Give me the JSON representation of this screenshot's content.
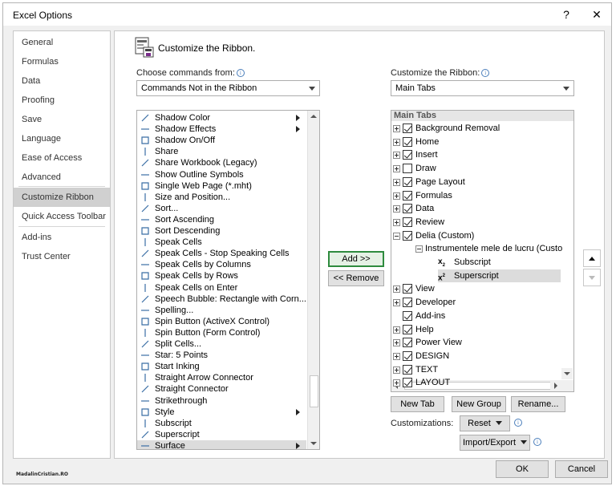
{
  "window": {
    "title": "Excel Options",
    "help_label": "?",
    "close_label": "✕"
  },
  "nav": {
    "items": [
      {
        "label": "General"
      },
      {
        "label": "Formulas"
      },
      {
        "label": "Data"
      },
      {
        "label": "Proofing"
      },
      {
        "label": "Save"
      },
      {
        "label": "Language"
      },
      {
        "label": "Ease of Access"
      },
      {
        "label": "Advanced"
      },
      {
        "label": "Customize Ribbon",
        "selected": true
      },
      {
        "label": "Quick Access Toolbar"
      },
      {
        "label": "Add-ins"
      },
      {
        "label": "Trust Center"
      }
    ]
  },
  "main": {
    "heading": "Customize the Ribbon.",
    "choose_label": "Choose commands from:",
    "choose_value": "Commands Not in the Ribbon",
    "customize_label": "Customize the Ribbon:",
    "customize_value": "Main Tabs",
    "commands": [
      {
        "label": "Shadow Color",
        "icon": "shadow-color-icon",
        "submenu": true
      },
      {
        "label": "Shadow Effects",
        "icon": "shadow-effects-icon",
        "submenu": true
      },
      {
        "label": "Shadow On/Off",
        "icon": "shadow-onoff-icon"
      },
      {
        "label": "Share",
        "icon": "share-icon"
      },
      {
        "label": "Share Workbook (Legacy)",
        "icon": "share-workbook-icon"
      },
      {
        "label": "Show Outline Symbols",
        "icon": "outline-symbols-icon"
      },
      {
        "label": "Single Web Page (*.mht)",
        "icon": "web-page-icon"
      },
      {
        "label": "Size and Position...",
        "icon": "size-position-icon"
      },
      {
        "label": "Sort...",
        "icon": "sort-icon"
      },
      {
        "label": "Sort Ascending",
        "icon": "sort-ascending-icon"
      },
      {
        "label": "Sort Descending",
        "icon": "sort-descending-icon"
      },
      {
        "label": "Speak Cells",
        "icon": "speak-cells-icon"
      },
      {
        "label": "Speak Cells - Stop Speaking Cells",
        "icon": "stop-speaking-icon"
      },
      {
        "label": "Speak Cells by Columns",
        "icon": "speak-columns-icon"
      },
      {
        "label": "Speak Cells by Rows",
        "icon": "speak-rows-icon"
      },
      {
        "label": "Speak Cells on Enter",
        "icon": "speak-enter-icon"
      },
      {
        "label": "Speech Bubble: Rectangle with Corn...",
        "icon": "speech-bubble-icon"
      },
      {
        "label": "Spelling...",
        "icon": "spelling-icon"
      },
      {
        "label": "Spin Button (ActiveX Control)",
        "icon": "spin-activex-icon"
      },
      {
        "label": "Spin Button (Form Control)",
        "icon": "spin-form-icon"
      },
      {
        "label": "Split Cells...",
        "icon": "split-cells-icon"
      },
      {
        "label": "Star: 5 Points",
        "icon": "star-icon"
      },
      {
        "label": "Start Inking",
        "icon": "inking-icon"
      },
      {
        "label": "Straight Arrow Connector",
        "icon": "arrow-connector-icon"
      },
      {
        "label": "Straight Connector",
        "icon": "connector-icon"
      },
      {
        "label": "Strikethrough",
        "icon": "strikethrough-icon"
      },
      {
        "label": "Style",
        "icon": "style-icon",
        "submenu": true
      },
      {
        "label": "Subscript",
        "icon": "subscript-icon"
      },
      {
        "label": "Superscript",
        "icon": "superscript-icon"
      },
      {
        "label": "Surface",
        "icon": "surface-icon",
        "submenu": true,
        "selected": true
      }
    ],
    "add_label": "Add >>",
    "remove_label": "<< Remove",
    "tree_header": "Main Tabs",
    "tree": [
      {
        "label": "Background Removal",
        "level": 0,
        "expander": "plus",
        "checked": true
      },
      {
        "label": "Home",
        "level": 0,
        "expander": "plus",
        "checked": true
      },
      {
        "label": "Insert",
        "level": 0,
        "expander": "plus",
        "checked": true
      },
      {
        "label": "Draw",
        "level": 0,
        "expander": "plus",
        "checked": false
      },
      {
        "label": "Page Layout",
        "level": 0,
        "expander": "plus",
        "checked": true
      },
      {
        "label": "Formulas",
        "level": 0,
        "expander": "plus",
        "checked": true
      },
      {
        "label": "Data",
        "level": 0,
        "expander": "plus",
        "checked": true
      },
      {
        "label": "Review",
        "level": 0,
        "expander": "plus",
        "checked": true
      },
      {
        "label": "Delia (Custom)",
        "level": 0,
        "expander": "minus",
        "checked": true
      },
      {
        "label": "Instrumentele mele de lucru  (Custo",
        "level": 1,
        "expander": "minus"
      },
      {
        "label": "Subscript",
        "level": 2,
        "icon": "subscript-icon"
      },
      {
        "label": "Superscript",
        "level": 2,
        "icon": "superscript-icon",
        "selected": true
      },
      {
        "label": "View",
        "level": 0,
        "expander": "plus",
        "checked": true
      },
      {
        "label": "Developer",
        "level": 0,
        "expander": "plus",
        "checked": true
      },
      {
        "label": "Add-ins",
        "level": 0,
        "checked": true
      },
      {
        "label": "Help",
        "level": 0,
        "expander": "plus",
        "checked": true
      },
      {
        "label": "Power View",
        "level": 0,
        "expander": "plus",
        "checked": true
      },
      {
        "label": "DESIGN",
        "level": 0,
        "expander": "plus",
        "checked": true
      },
      {
        "label": "TEXT",
        "level": 0,
        "expander": "plus",
        "checked": true
      },
      {
        "label": "LAYOUT",
        "level": 0,
        "expander": "plus",
        "checked": true
      }
    ],
    "new_tab_label": "New Tab",
    "new_group_label": "New Group",
    "rename_label": "Rename...",
    "customizations_label": "Customizations:",
    "reset_label": "Reset",
    "import_export_label": "Import/Export"
  },
  "footer": {
    "ok_label": "OK",
    "cancel_label": "Cancel",
    "watermark": "MadalinCristian.RO"
  },
  "colors": {
    "accent": "#2e8b3e",
    "selection": "#d0d0d0"
  }
}
